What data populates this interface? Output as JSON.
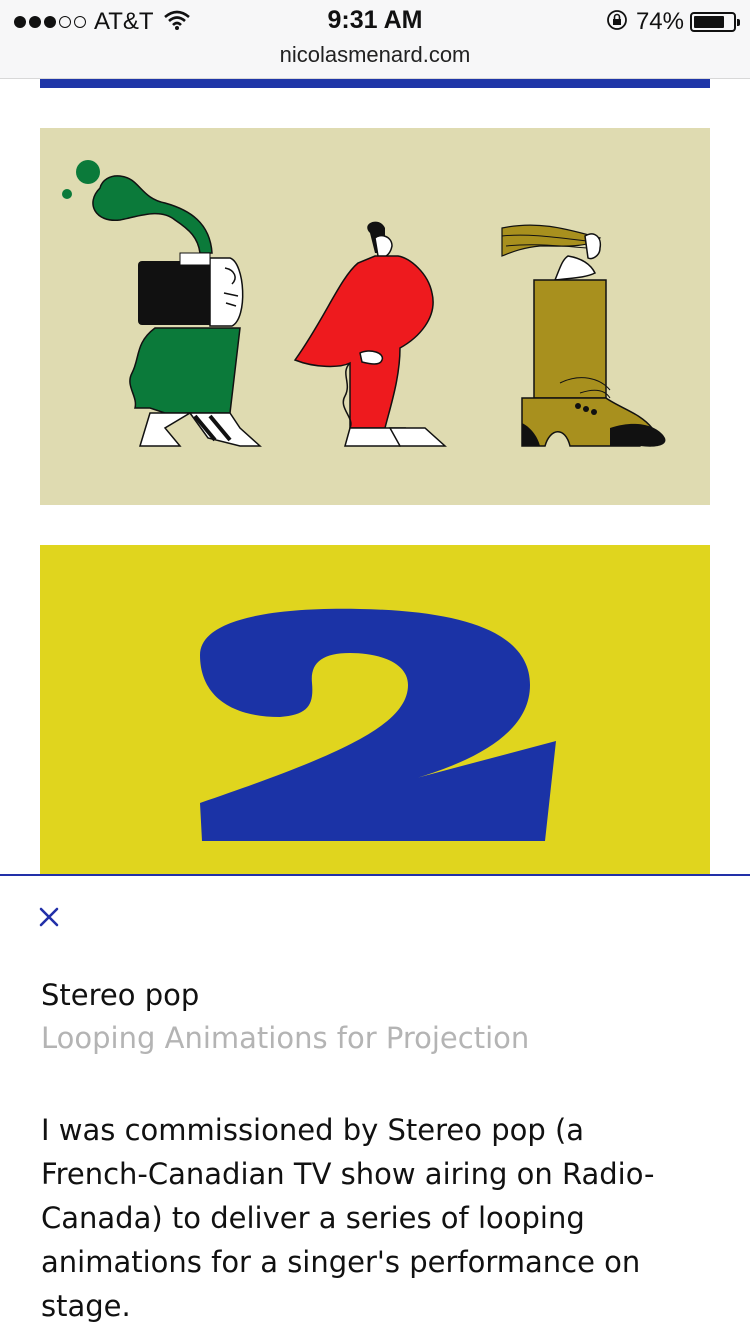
{
  "status_bar": {
    "carrier": "AT&T",
    "signal_bars_filled": 3,
    "signal_bars_total": 5,
    "time": "9:31 AM",
    "battery_percent": "74%",
    "battery_level": 0.74,
    "icons": [
      "signal-dots-icon",
      "wifi-icon",
      "rotation-lock-icon",
      "battery-icon"
    ]
  },
  "browser": {
    "url": "nicolasmenard.com"
  },
  "colors": {
    "accent_blue": "#1f36a8",
    "panel1_bg": "#dfdbb1",
    "panel2_bg": "#e0d51e",
    "subtitle_gray": "#b4b4b4"
  },
  "gallery": {
    "illustration_1": "three-figures-illustration",
    "illustration_2": "number-two-illustration"
  },
  "project": {
    "close_icon": "close-icon",
    "title": "Stereo pop",
    "subtitle": "Looping Animations for Projection",
    "description": "I was commissioned by Stereo pop (a French-Canadian TV show airing on Radio-Canada) to deliver a series of looping animations for a singer's performance on stage."
  }
}
